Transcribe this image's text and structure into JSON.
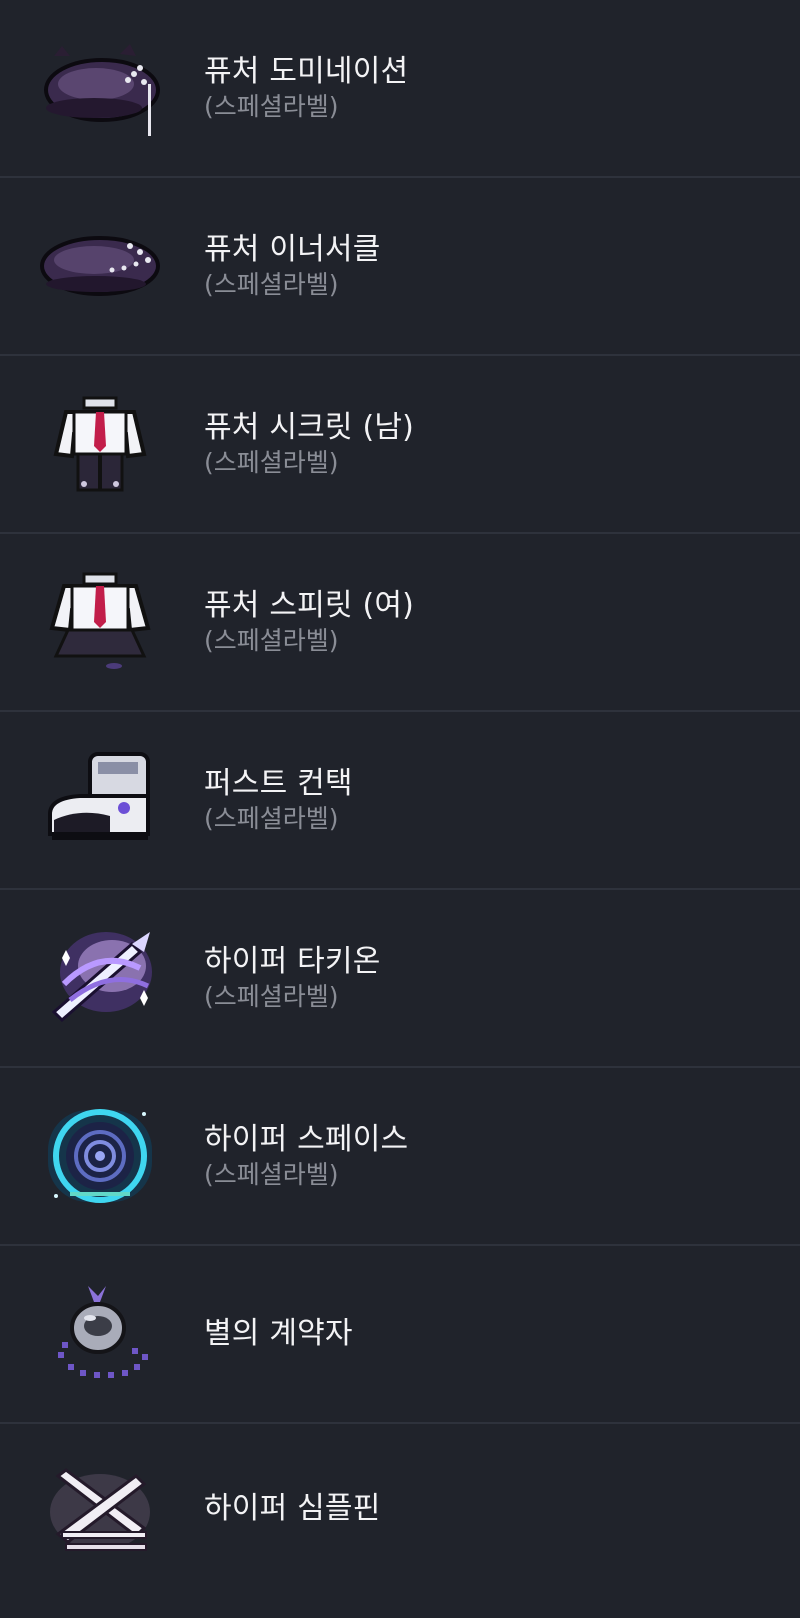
{
  "items": [
    {
      "name": "퓨처 도미네이션",
      "sub": "(스페셜라벨)",
      "icon": "beret-dark-chain-icon"
    },
    {
      "name": "퓨처 이너서클",
      "sub": "(스페셜라벨)",
      "icon": "beret-dark-icon"
    },
    {
      "name": "퓨처 시크릿 (남)",
      "sub": "(스페셜라벨)",
      "icon": "school-uniform-male-icon"
    },
    {
      "name": "퓨처 스피릿 (여)",
      "sub": "(스페셜라벨)",
      "icon": "school-uniform-female-icon"
    },
    {
      "name": "퍼스트 컨택",
      "sub": "(스페셜라벨)",
      "icon": "boots-icon"
    },
    {
      "name": "하이퍼 타키온",
      "sub": "(스페셜라벨)",
      "icon": "sword-galaxy-icon"
    },
    {
      "name": "하이퍼 스페이스",
      "sub": "(스페셜라벨)",
      "icon": "portal-ring-icon"
    },
    {
      "name": "별의 계약자",
      "sub": "",
      "icon": "pendant-stone-icon"
    },
    {
      "name": "하이퍼 심플핀",
      "sub": "",
      "icon": "hairpin-cross-icon"
    }
  ]
}
